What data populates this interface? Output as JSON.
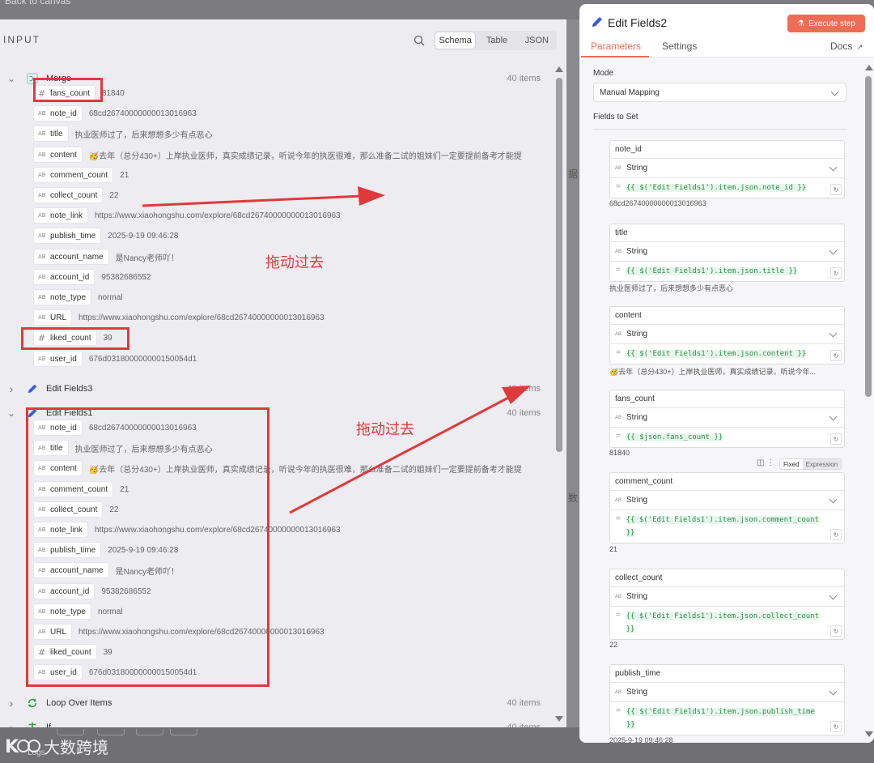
{
  "background": {
    "top_ghost_text": "Back to canvas",
    "peek_texts": [
      "据",
      "数"
    ],
    "logs_label": "Logs"
  },
  "input_panel": {
    "title": "INPUT",
    "view_tabs": [
      "Schema",
      "Table",
      "JSON"
    ],
    "active_view": "Schema",
    "nodes": [
      {
        "name": "Merge",
        "count": "40 items",
        "expanded": true,
        "icon": "merge-icon",
        "fields": [
          {
            "type": "#",
            "name": "fans_count",
            "value": "81840"
          },
          {
            "type": "AB",
            "name": "note_id",
            "value": "68cd26740000000013016963"
          },
          {
            "type": "AB",
            "name": "title",
            "value": "执业医师过了，后来想想多少有点恶心"
          },
          {
            "type": "AB",
            "name": "content",
            "value": "🥳去年（总分430+）上岸执业医师，真实成绩记录，听说今年的执医很难，那么准备二试的姐妹们一定要提前备考才能提"
          },
          {
            "type": "AB",
            "name": "comment_count",
            "value": "21"
          },
          {
            "type": "AB",
            "name": "collect_count",
            "value": "22"
          },
          {
            "type": "AB",
            "name": "note_link",
            "value": "https://www.xiaohongshu.com/explore/68cd26740000000013016963"
          },
          {
            "type": "AB",
            "name": "publish_time",
            "value": "2025-9-19 09:46:28"
          },
          {
            "type": "AB",
            "name": "account_name",
            "value": "是Nancy老师吖！"
          },
          {
            "type": "AB",
            "name": "account_id",
            "value": "95382686552"
          },
          {
            "type": "AB",
            "name": "note_type",
            "value": "normal"
          },
          {
            "type": "AB",
            "name": "URL",
            "value": "https://www.xiaohongshu.com/explore/68cd26740000000013016963"
          },
          {
            "type": "#",
            "name": "liked_count",
            "value": "39"
          },
          {
            "type": "AB",
            "name": "user_id",
            "value": "676d031800000000150054d1"
          }
        ]
      },
      {
        "name": "Edit Fields3",
        "count": "40 items",
        "expanded": false,
        "icon": "pencil-icon",
        "fields": []
      },
      {
        "name": "Edit Fields1",
        "count": "40 items",
        "expanded": true,
        "icon": "pencil-icon",
        "fields": [
          {
            "type": "AB",
            "name": "note_id",
            "value": "68cd26740000000013016963"
          },
          {
            "type": "AB",
            "name": "title",
            "value": "执业医师过了，后来想想多少有点恶心"
          },
          {
            "type": "AB",
            "name": "content",
            "value": "🥳去年（总分430+）上岸执业医师，真实成绩记录，听说今年的执医很难，那么准备二试的姐妹们一定要提前备考才能提"
          },
          {
            "type": "AB",
            "name": "comment_count",
            "value": "21"
          },
          {
            "type": "AB",
            "name": "collect_count",
            "value": "22"
          },
          {
            "type": "AB",
            "name": "note_link",
            "value": "https://www.xiaohongshu.com/explore/68cd26740000000013016963"
          },
          {
            "type": "AB",
            "name": "publish_time",
            "value": "2025-9-19 09:46:28"
          },
          {
            "type": "AB",
            "name": "account_name",
            "value": "是Nancy老师吖！"
          },
          {
            "type": "AB",
            "name": "account_id",
            "value": "95382686552"
          },
          {
            "type": "AB",
            "name": "note_type",
            "value": "normal"
          },
          {
            "type": "AB",
            "name": "URL",
            "value": "https://www.xiaohongshu.com/explore/68cd26740000000013016963"
          },
          {
            "type": "#",
            "name": "liked_count",
            "value": "39"
          },
          {
            "type": "AB",
            "name": "user_id",
            "value": "676d031800000000150054d1"
          }
        ]
      },
      {
        "name": "Loop Over Items",
        "count": "40 items",
        "expanded": false,
        "icon": "loop-icon",
        "fields": []
      },
      {
        "name": "If",
        "count": "40 items",
        "expanded": false,
        "icon": "if-icon",
        "fields": []
      }
    ]
  },
  "annotations": {
    "drag_text_1": "拖动过去",
    "drag_text_2": "拖动过去",
    "color": "#e0393b"
  },
  "watermark": {
    "logo_text": "K",
    "text": "大数跨境"
  },
  "right_panel": {
    "title": "Edit Fields2",
    "execute_label": "Execute step",
    "tabs": [
      "Parameters",
      "Settings"
    ],
    "active_tab": "Parameters",
    "docs_label": "Docs",
    "mode_label": "Mode",
    "mode_value": "Manual Mapping",
    "fields_to_set_label": "Fields to Set",
    "fixed_label": "Fixed",
    "expression_label": "Expression",
    "cards": [
      {
        "name": "note_id",
        "type": "String",
        "expr": "{{ $('Edit Fields1').item.json.note_id }}",
        "preview": "68cd26740000000013016963"
      },
      {
        "name": "title",
        "type": "String",
        "expr": "{{ $('Edit Fields1').item.json.title }}",
        "preview": "执业医师过了，后来想想多少有点恶心"
      },
      {
        "name": "content",
        "type": "String",
        "expr": "{{ $('Edit Fields1').item.json.content }}",
        "preview": "🥳去年（总分430+）上岸执业医师，真实成绩记录，听说今年..."
      },
      {
        "name": "fans_count",
        "type": "String",
        "expr": "{{ $json.fans_count }}",
        "preview": "81840"
      },
      {
        "name": "comment_count",
        "type": "String",
        "expr": "{{ $('Edit Fields1').item.json.comment_count }}",
        "preview": "21"
      },
      {
        "name": "collect_count",
        "type": "String",
        "expr": "{{ $('Edit Fields1').item.json.collect_count }}",
        "preview": "22"
      },
      {
        "name": "publish_time",
        "type": "String",
        "expr": "{{ $('Edit Fields1').item.json.publish_time }}",
        "preview": "2025-9-19 09:46:28"
      }
    ]
  },
  "colors": {
    "accent": "#ef6c55",
    "annotation": "#e0393b",
    "code_green": "#2e8b4a"
  }
}
